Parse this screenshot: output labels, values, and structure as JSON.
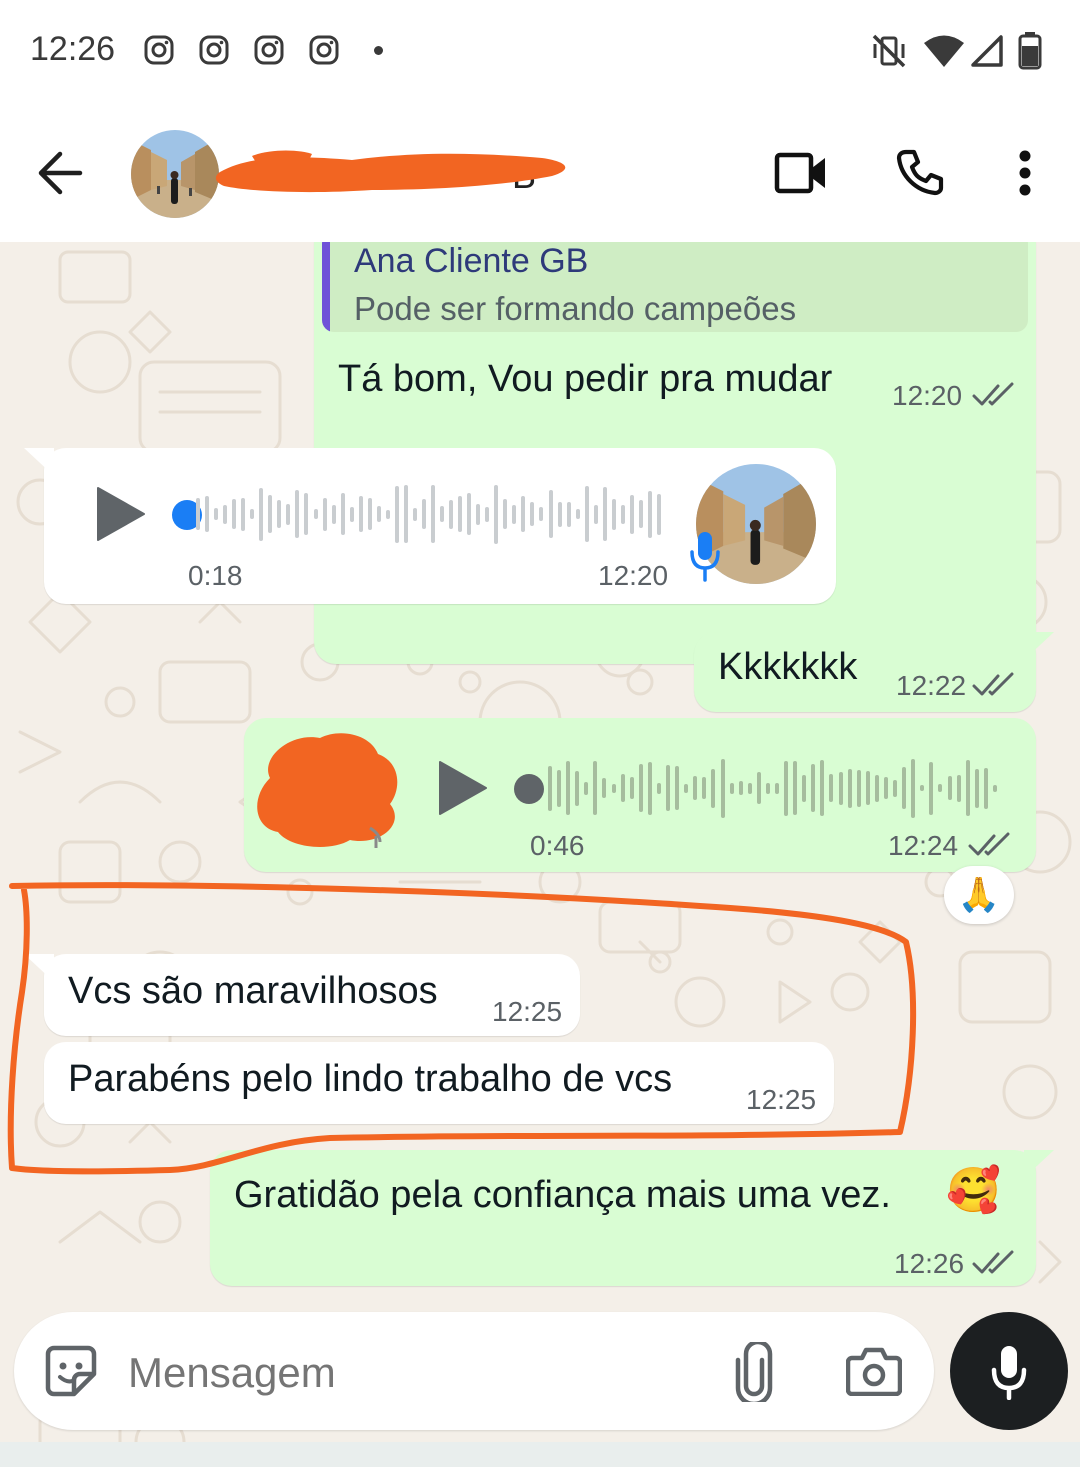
{
  "status_bar": {
    "time": "12:26",
    "notification_icons": [
      "instagram-icon",
      "instagram-icon",
      "instagram-icon",
      "instagram-icon"
    ],
    "system_icons": [
      "vibrate-off-icon",
      "wifi-icon",
      "signal-icon",
      "battery-icon"
    ]
  },
  "header": {
    "contact_name": "",
    "actions": [
      "video-call-icon",
      "voice-call-icon",
      "more-options-icon"
    ]
  },
  "messages": [
    {
      "direction": "outgoing",
      "type": "reply",
      "quote_author": "Ana Cliente GB",
      "quote_text": "Pode ser formando campeões",
      "text": "Tá bom, Vou pedir pra mudar",
      "time": "12:20",
      "status": "read"
    },
    {
      "direction": "incoming",
      "type": "voice",
      "duration": "0:18",
      "time": "12:20"
    },
    {
      "direction": "outgoing",
      "type": "text",
      "text": "Kkkkkkk",
      "time": "12:22",
      "status": "read"
    },
    {
      "direction": "outgoing",
      "type": "voice",
      "duration": "0:46",
      "time": "12:24",
      "status": "read",
      "reaction": "🙏"
    },
    {
      "direction": "incoming",
      "type": "text",
      "text": "Vcs são maravilhosos",
      "time": "12:25"
    },
    {
      "direction": "incoming",
      "type": "text",
      "text": "Parabéns pelo lindo trabalho de vcs",
      "time": "12:25"
    },
    {
      "direction": "outgoing",
      "type": "text",
      "text": "Gratidão pela confiança mais uma vez.",
      "emoji": "🥰",
      "time": "12:26",
      "status": "read"
    }
  ],
  "composer": {
    "placeholder": "Mensagem",
    "icons": [
      "sticker-icon",
      "attach-icon",
      "camera-icon",
      "mic-icon"
    ]
  },
  "colors": {
    "outgoing_bubble": "#d9fdd3",
    "incoming_bubble": "#ffffff",
    "chat_background": "#f4efe8",
    "quote_bar": "#6f52d8",
    "unplayed_dot": "#1a7ef5",
    "annotation_outline": "#f26522",
    "redaction": "#f26522"
  }
}
